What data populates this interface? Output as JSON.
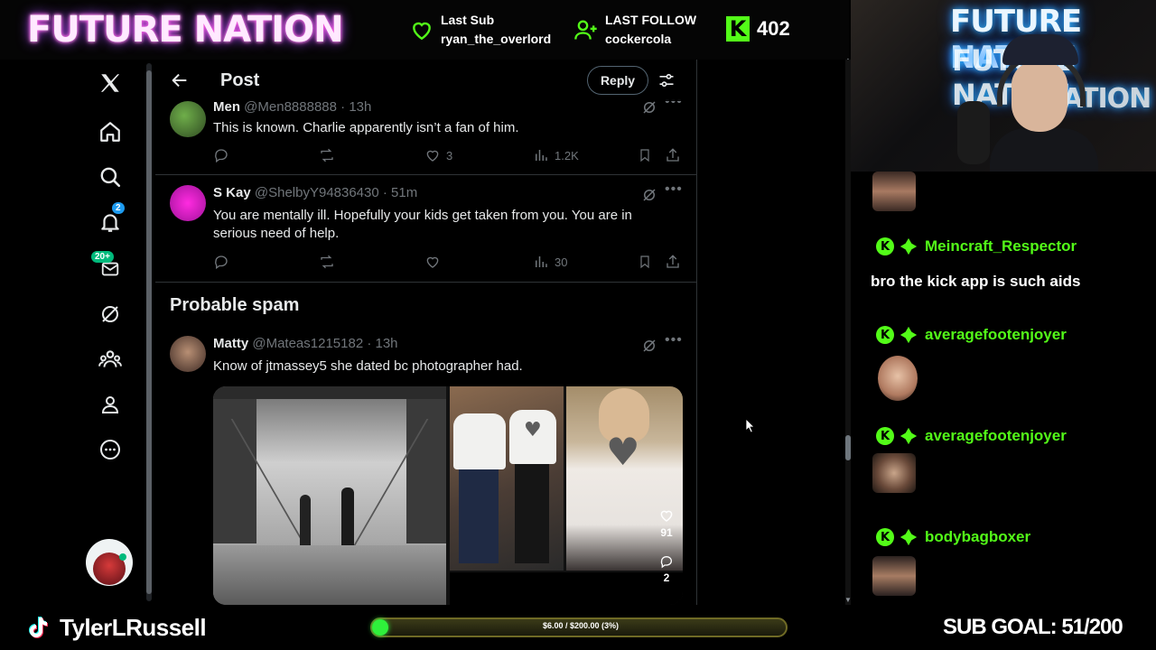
{
  "overlay": {
    "brand": "FUTURE NATION",
    "last_sub_label": "Last Sub",
    "last_sub_name": "ryan_the_overlord",
    "last_follow_label": "LAST FOLLOW",
    "last_follow_name": "cockercola",
    "kick_icon": "K",
    "kick_count": "402",
    "handle": "TylerLRussell",
    "goal_text": "$6.00 / $200.00 (3%)",
    "goal_progress": 0.03,
    "sub_goal": "SUB GOAL: 51/200",
    "accent": "#53fc18"
  },
  "twitter": {
    "header_title": "Post",
    "reply_button": "Reply",
    "notifications_badge": "2",
    "messages_badge": "20+",
    "spam_heading": "Probable spam",
    "tweets": [
      {
        "name": "Men",
        "handle": "@Men8888888",
        "time": "· 13h",
        "text": "This is known. Charlie apparently isn’t a fan of him.",
        "likes": "3",
        "views": "1.2K"
      },
      {
        "name": "S Kay",
        "handle": "@ShelbyY94836430",
        "time": "· 51m",
        "text": "You are mentally ill.  Hopefully your kids get taken from you.  You are in serious need of help.",
        "likes": "",
        "views": "30"
      },
      {
        "name": "Matty",
        "handle": "@Mateas1215182",
        "time": "· 13h",
        "text": "Know of jtmassey5 she dated bc photographer had."
      }
    ],
    "media": {
      "likes_overlay": "91",
      "comments_overlay": "2"
    }
  },
  "chat": {
    "kick_letter": "K",
    "messages": [
      {
        "user": "Meincraft_Respector",
        "text": "bro the kick app is such aids"
      },
      {
        "user": "averagefootenjoyer",
        "text": ""
      },
      {
        "user": "averagefootenjoyer",
        "text": ""
      },
      {
        "user": "bodybagboxer",
        "text": ""
      }
    ]
  },
  "cam": {
    "neon_lines": [
      "FUTURE NATION",
      "FUTURE NATION",
      "NATION"
    ]
  }
}
